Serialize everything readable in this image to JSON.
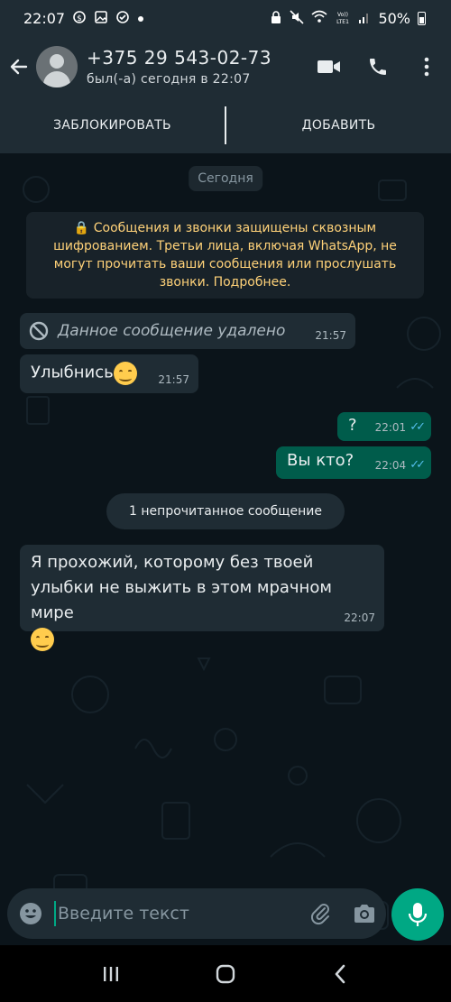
{
  "status_bar": {
    "time": "22:07",
    "battery": "50%",
    "left_icons": [
      "money-icon",
      "image-icon",
      "check-circle-icon",
      "dot-icon"
    ],
    "right_icons": [
      "lock-icon",
      "mute-icon",
      "wifi-icon",
      "volte-icon",
      "signal-icon",
      "battery-icon"
    ]
  },
  "header": {
    "contact_name": "+375 29 543-02-73",
    "last_seen": "был(-а) сегодня в 22:07",
    "icons": [
      "back-arrow-icon",
      "avatar",
      "video-call-icon",
      "phone-icon",
      "more-icon"
    ]
  },
  "action_bar": {
    "block_label": "ЗАБЛОКИРОВАТЬ",
    "add_label": "ДОБАВИТЬ"
  },
  "chat": {
    "date_chip": "Сегодня",
    "encryption_notice": "🔒 Сообщения и звонки защищены сквозным шифрованием. Третьи лица, включая WhatsApp, не могут прочитать ваши сообщения или прослушать звонки. Подробнее.",
    "messages": [
      {
        "direction": "in",
        "text": "Данное сообщение удалено",
        "time": "21:57",
        "deleted": true
      },
      {
        "direction": "in",
        "text": "Улыбнись",
        "emoji": "smiling-face-icon",
        "time": "21:57"
      },
      {
        "direction": "out",
        "text": "?",
        "time": "22:01",
        "status": "read"
      },
      {
        "direction": "out",
        "text": "Вы кто?",
        "time": "22:04",
        "status": "read"
      },
      {
        "direction": "in",
        "text": "Я прохожий, которому без твоей улыбки не выжить в этом мрачном мире",
        "emoji": "face-holding-back-tears-icon",
        "time": "22:07"
      }
    ],
    "unread_chip": "1 непрочитанное сообщение",
    "read_ticks": "✓✓"
  },
  "input": {
    "placeholder": "Введите текст",
    "icons": [
      "emoji-icon",
      "attach-icon",
      "camera-icon",
      "mic-icon"
    ]
  },
  "nav": {
    "icons": [
      "recent-apps-icon",
      "home-icon",
      "back-icon"
    ]
  },
  "colors": {
    "header_bg": "#1f2c34",
    "chat_bg": "#0b141a",
    "incoming_bubble": "#1f2c34",
    "outgoing_bubble": "#005c4b",
    "accent": "#00a884",
    "notice_text": "#ffd279",
    "read_ticks": "#53bdeb"
  }
}
